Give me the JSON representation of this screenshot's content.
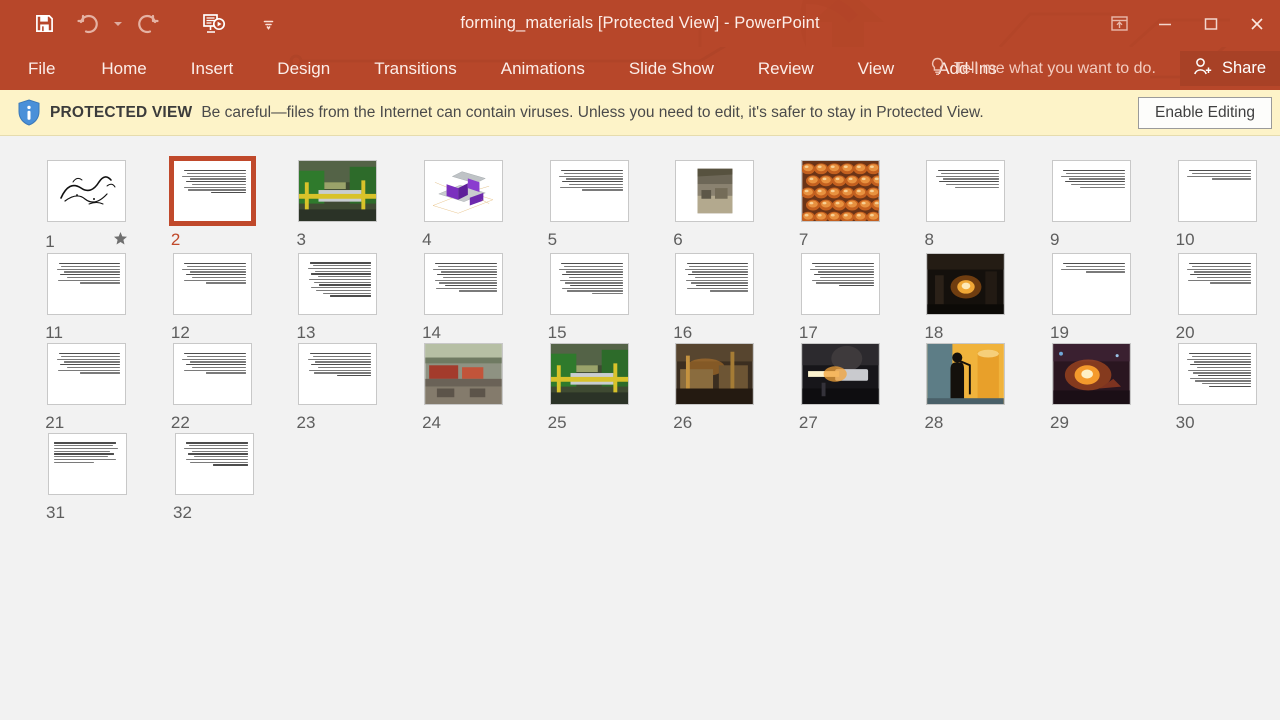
{
  "window": {
    "title": "forming_materials [Protected View] - PowerPoint",
    "accent": "#b7472a",
    "titlebar_text": "#fdeee9"
  },
  "quick_access": [
    {
      "name": "save-button",
      "icon": "save-icon",
      "enabled": true
    },
    {
      "name": "undo-button",
      "icon": "undo-icon",
      "enabled": false
    },
    {
      "name": "redo-button",
      "icon": "redo-icon",
      "enabled": false
    },
    {
      "name": "start-presentation-button",
      "icon": "slideshow-icon",
      "enabled": true
    },
    {
      "name": "customize-qat-button",
      "icon": "chevron-down-icon",
      "enabled": true
    }
  ],
  "window_controls": [
    {
      "name": "ribbon-display-options-button",
      "icon": "ribbon-options-icon"
    },
    {
      "name": "minimize-button",
      "icon": "minimize-icon"
    },
    {
      "name": "restore-button",
      "icon": "restore-icon"
    },
    {
      "name": "close-button",
      "icon": "close-icon"
    }
  ],
  "ribbon": {
    "tabs": [
      {
        "label": "File",
        "active": false
      },
      {
        "label": "Home",
        "active": false
      },
      {
        "label": "Insert",
        "active": false
      },
      {
        "label": "Design",
        "active": false
      },
      {
        "label": "Transitions",
        "active": false
      },
      {
        "label": "Animations",
        "active": false
      },
      {
        "label": "Slide Show",
        "active": false
      },
      {
        "label": "Review",
        "active": false
      },
      {
        "label": "View",
        "active": false
      },
      {
        "label": "Add-Ins",
        "active": false
      }
    ],
    "tell_me": "Tell me what you want to do.",
    "tell_me_icon": "lightbulb-icon",
    "share_label": "Share",
    "share_icon": "person-add-icon"
  },
  "protected_view": {
    "icon": "info-shield-icon",
    "label": "PROTECTED VIEW",
    "message": "Be careful—files from the Internet can contain viruses. Unless you need to edit, it's safer to stay in Protected View.",
    "button_label": "Enable Editing",
    "background": "#fdf3c8"
  },
  "slide_sorter": {
    "selected_slide": 2,
    "selection_color": "#c0492b",
    "background": "#f2f2f2",
    "columns": 10,
    "slides": [
      {
        "number": "1",
        "kind": "image",
        "image": "calligraphy",
        "animated": true
      },
      {
        "number": "2",
        "kind": "text",
        "title": true,
        "lines": 9,
        "selected": true
      },
      {
        "number": "3",
        "kind": "image",
        "image": "rolling-mill-green"
      },
      {
        "number": "4",
        "kind": "image",
        "image": "purple-diagram"
      },
      {
        "number": "5",
        "kind": "text",
        "title": true,
        "lines": 8
      },
      {
        "number": "6",
        "kind": "image",
        "image": "warehouse"
      },
      {
        "number": "7",
        "kind": "image",
        "image": "copper-vessels"
      },
      {
        "number": "8",
        "kind": "text",
        "title": true,
        "lines": 7
      },
      {
        "number": "9",
        "kind": "text",
        "title": true,
        "lines": 7
      },
      {
        "number": "10",
        "kind": "text",
        "title": true,
        "lines": 4
      },
      {
        "number": "11",
        "kind": "text",
        "title": true,
        "lines": 8
      },
      {
        "number": "12",
        "kind": "text",
        "title": true,
        "lines": 8
      },
      {
        "number": "13",
        "kind": "text",
        "title": false,
        "lines": 13
      },
      {
        "number": "14",
        "kind": "text",
        "title": true,
        "lines": 11
      },
      {
        "number": "15",
        "kind": "text",
        "title": true,
        "lines": 12
      },
      {
        "number": "16",
        "kind": "text",
        "title": true,
        "lines": 11
      },
      {
        "number": "17",
        "kind": "text",
        "title": true,
        "lines": 9
      },
      {
        "number": "18",
        "kind": "image",
        "image": "forge-dark"
      },
      {
        "number": "19",
        "kind": "text",
        "title": true,
        "lines": 4
      },
      {
        "number": "20",
        "kind": "text",
        "title": true,
        "lines": 8
      },
      {
        "number": "21",
        "kind": "text",
        "title": true,
        "lines": 8
      },
      {
        "number": "22",
        "kind": "text",
        "title": true,
        "lines": 8
      },
      {
        "number": "23",
        "kind": "text",
        "title": true,
        "title_red": true,
        "lines": 9
      },
      {
        "number": "24",
        "kind": "image",
        "image": "factory-line"
      },
      {
        "number": "25",
        "kind": "image",
        "image": "rolling-mill-green"
      },
      {
        "number": "26",
        "kind": "image",
        "image": "steel-mill"
      },
      {
        "number": "27",
        "kind": "image",
        "image": "hot-billet"
      },
      {
        "number": "28",
        "kind": "image",
        "image": "worker-silhouette"
      },
      {
        "number": "29",
        "kind": "image",
        "image": "fire-dark"
      },
      {
        "number": "30",
        "kind": "text",
        "title": true,
        "lines": 13
      },
      {
        "number": "31",
        "kind": "text",
        "title": false,
        "lines": 8,
        "ltr": true
      },
      {
        "number": "32",
        "kind": "text",
        "title": false,
        "lines": 9
      }
    ],
    "animation_icon": "star-animation-icon"
  }
}
